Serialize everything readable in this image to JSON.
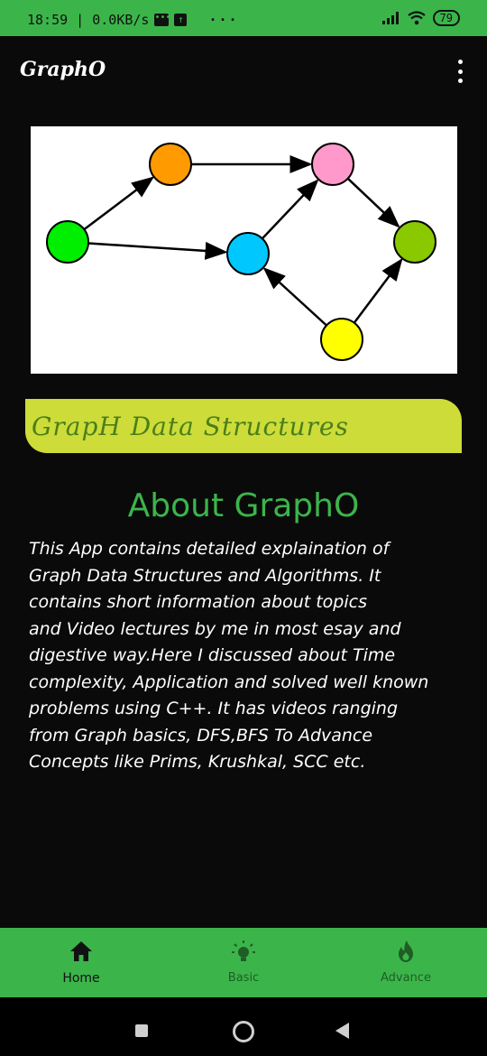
{
  "status_bar": {
    "left_text": "18:59 | 0.0KB/s",
    "battery": "79"
  },
  "app": {
    "title": "GraphO"
  },
  "hero": {
    "nodes": [
      {
        "id": "green",
        "color": "#00ee00"
      },
      {
        "id": "orange",
        "color": "#ff9a00"
      },
      {
        "id": "pink",
        "color": "#ff99cc"
      },
      {
        "id": "cyan",
        "color": "#00c8ff"
      },
      {
        "id": "olive",
        "color": "#8ac800"
      },
      {
        "id": "yellow",
        "color": "#ffff00"
      }
    ],
    "edges": [
      [
        "green",
        "orange"
      ],
      [
        "orange",
        "pink"
      ],
      [
        "green",
        "cyan"
      ],
      [
        "cyan",
        "pink"
      ],
      [
        "pink",
        "olive"
      ],
      [
        "yellow",
        "cyan"
      ],
      [
        "yellow",
        "olive"
      ]
    ]
  },
  "banner": {
    "text": "GrapH Data Structures"
  },
  "about": {
    "title": "About GraphO",
    "lines": [
      "This App contains detailed explaination of",
      "Graph Data Structures and Algorithms. It",
      "contains short information about topics",
      "and Video lectures by me in most esay and",
      "digestive way.Here I discussed about Time",
      "complexity, Application and solved well known",
      "problems using C++. It has videos ranging",
      "from Graph basics, DFS,BFS To Advance",
      "Concepts like Prims, Krushkal, SCC etc."
    ]
  },
  "bottom_nav": [
    {
      "label": "Home",
      "icon": "home-icon",
      "active": true
    },
    {
      "label": "Basic",
      "icon": "bulb-icon",
      "active": false
    },
    {
      "label": "Advance",
      "icon": "flame-icon",
      "active": false
    }
  ],
  "colors": {
    "accent": "#3bb54a",
    "banner": "#cddc39"
  }
}
